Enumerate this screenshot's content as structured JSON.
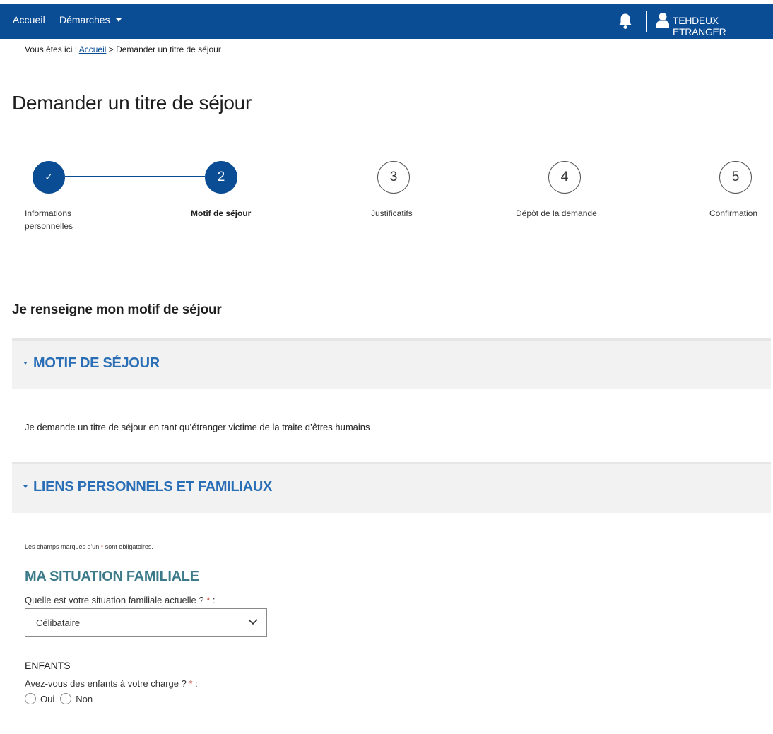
{
  "topbar": {
    "accueil": "Accueil",
    "demarches": "Démarches",
    "user_name": "TEHDEUX ETRANGER"
  },
  "breadcrumb": {
    "prefix": "Vous êtes ici : ",
    "home": "Accueil",
    "current": " > Demander un titre de séjour"
  },
  "page_title": "Demander un titre de séjour",
  "stepper": {
    "current_step": 2,
    "steps": [
      {
        "number": "✓",
        "label_line1": "Informations",
        "label_line2": "personnelles",
        "state": "done"
      },
      {
        "number": "2",
        "label_line1": "Motif de séjour",
        "label_line2": "",
        "state": "active"
      },
      {
        "number": "3",
        "label_line1": "Justificatifs",
        "label_line2": "",
        "state": "todo"
      },
      {
        "number": "4",
        "label_line1": "Dépôt de la demande",
        "label_line2": "",
        "state": "todo"
      },
      {
        "number": "5",
        "label_line1": "Confirmation",
        "label_line2": "",
        "state": "todo"
      }
    ]
  },
  "section_title": "Je renseigne mon motif de séjour",
  "accordion_motif": {
    "title": "MOTIF DE SÉJOUR"
  },
  "motif_text": "Je demande un titre de séjour en tant qu’étranger victime de la traite d’êtres humains",
  "accordion_liens": {
    "title": "LIENS PERSONNELS ET FAMILIAUX"
  },
  "mandatory_note": {
    "before": "Les champs marqués d'un ",
    "star": "*",
    "after": " sont obligatoires."
  },
  "situation": {
    "title": "MA SITUATION FAMILIALE",
    "question": "Quelle est votre situation familiale actuelle ? ",
    "star": "*",
    "suffix": " :",
    "selected": "Célibataire"
  },
  "enfants": {
    "title": "ENFANTS",
    "question": "Avez-vous des enfants à votre charge ? ",
    "star": "*",
    "suffix": " :",
    "option_yes": "Oui",
    "option_no": "Non"
  },
  "colors": {
    "brand": "#0a4d94",
    "accordion_title": "#2a6fb6",
    "subsection_title": "#3c7a8a",
    "required": "#c0392b"
  }
}
